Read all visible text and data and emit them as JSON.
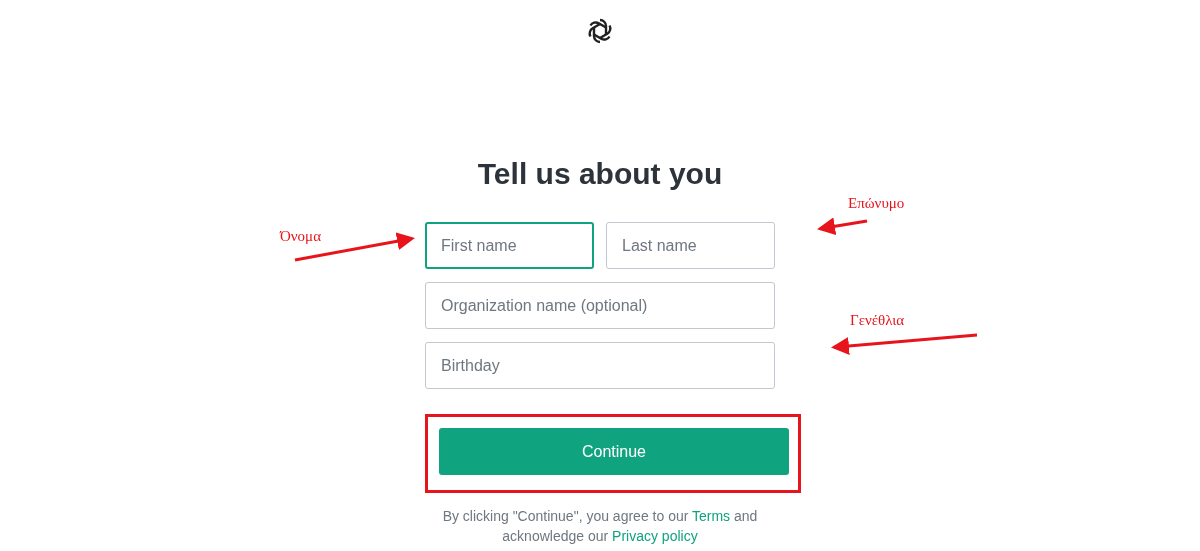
{
  "title": "Tell us about you",
  "fields": [
    {
      "placeholder": "First name",
      "focused": true
    },
    {
      "placeholder": "Last name",
      "focused": false
    },
    {
      "placeholder": "Organization name (optional)",
      "focused": false
    },
    {
      "placeholder": "Birthday",
      "focused": false
    }
  ],
  "continue_button": {
    "label": "Continue",
    "highlighted": true
  },
  "legal": [
    {
      "kind": "text",
      "text": "By clicking \"Continue\", you agree to our "
    },
    {
      "kind": "link",
      "text": "Terms"
    },
    {
      "kind": "text",
      "text": " and acknowledge our "
    },
    {
      "kind": "link",
      "text": "Privacy policy"
    }
  ],
  "annotations": [
    {
      "label": "Όνομα"
    },
    {
      "label": "Επώνυμο"
    },
    {
      "label": "Γενέθλια"
    }
  ]
}
